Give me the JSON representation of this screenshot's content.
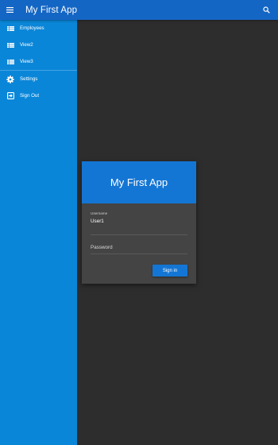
{
  "appbar": {
    "title": "My First App",
    "menu_icon": "hamburger-menu-icon",
    "search_icon": "search-icon"
  },
  "drawer": {
    "items": [
      {
        "label": "Employees",
        "icon": "view-list-icon"
      },
      {
        "label": "View2",
        "icon": "view-list-icon"
      },
      {
        "label": "View3",
        "icon": "view-list-icon"
      },
      {
        "label": "Settings",
        "icon": "gear-icon"
      },
      {
        "label": "Sign Out",
        "icon": "exit-icon"
      }
    ]
  },
  "login": {
    "title": "My First App",
    "username_label": "Username",
    "username_value": "User1",
    "password_placeholder": "Password",
    "signin_label": "Sign in"
  },
  "colors": {
    "appbar": "#1466c4",
    "drawer": "#0a86d8",
    "background": "#2d2d2d",
    "card": "#444444",
    "accent": "#1476d4"
  }
}
